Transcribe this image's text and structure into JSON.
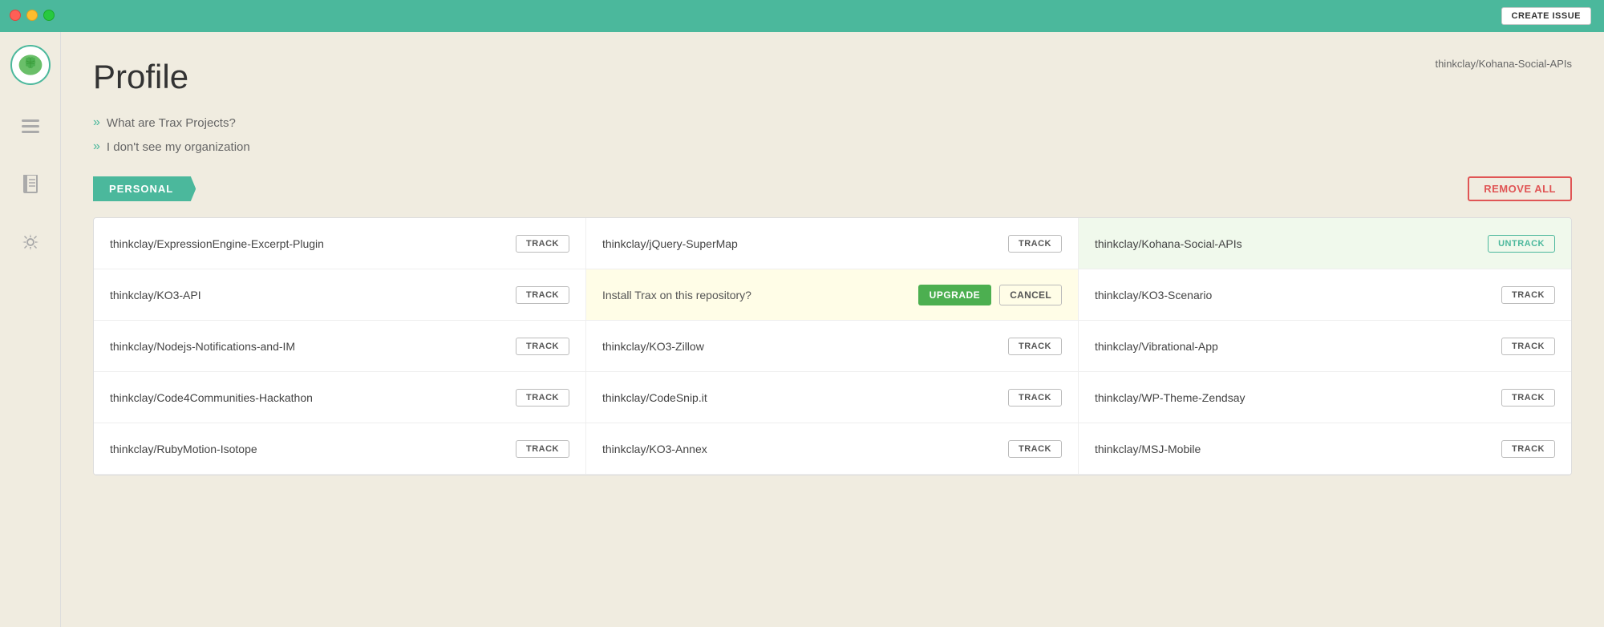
{
  "titlebar": {
    "create_issue_label": "CREATE ISSUE"
  },
  "sidebar": {
    "avatar_alt": "brain avatar",
    "icons": [
      {
        "name": "list-icon",
        "symbol": "☰"
      },
      {
        "name": "book-icon",
        "symbol": "📖"
      },
      {
        "name": "gear-icon",
        "symbol": "⚙"
      }
    ]
  },
  "page": {
    "title": "Profile",
    "top_right_repo": "thinkclay/Kohana-Social-APIs",
    "faq": [
      {
        "text": "What are Trax Projects?"
      },
      {
        "text": "I don't see my organization"
      }
    ]
  },
  "personal_section": {
    "label": "PERSONAL",
    "remove_all_label": "REMOVE ALL"
  },
  "repos": [
    {
      "col": 0,
      "name": "thinkclay/ExpressionEngine-Excerpt-Plugin",
      "action": "track",
      "highlighted": false,
      "yellow": false
    },
    {
      "col": 1,
      "name": "thinkclay/jQuery-SuperMap",
      "action": "track",
      "highlighted": false,
      "yellow": false
    },
    {
      "col": 2,
      "name": "thinkclay/Kohana-Social-APIs",
      "action": "untrack",
      "highlighted": true,
      "yellow": false
    },
    {
      "col": 0,
      "name": "thinkclay/KO3-API",
      "action": "track",
      "highlighted": false,
      "yellow": false
    },
    {
      "col": 1,
      "name": "Install Trax on this repository?",
      "action": "upgrade_cancel",
      "highlighted": false,
      "yellow": true,
      "upgrade_label": "UPGRADE",
      "cancel_label": "CANCEL"
    },
    {
      "col": 2,
      "name": "thinkclay/KO3-Scenario",
      "action": "track",
      "highlighted": false,
      "yellow": false
    },
    {
      "col": 0,
      "name": "thinkclay/Nodejs-Notifications-and-IM",
      "action": "track",
      "highlighted": false,
      "yellow": false
    },
    {
      "col": 1,
      "name": "thinkclay/KO3-Zillow",
      "action": "track",
      "highlighted": false,
      "yellow": false
    },
    {
      "col": 2,
      "name": "thinkclay/Vibrational-App",
      "action": "track",
      "highlighted": false,
      "yellow": false
    },
    {
      "col": 0,
      "name": "thinkclay/Code4Communities-Hackathon",
      "action": "track",
      "highlighted": false,
      "yellow": false
    },
    {
      "col": 1,
      "name": "thinkclay/CodeSnip.it",
      "action": "track",
      "highlighted": false,
      "yellow": false
    },
    {
      "col": 2,
      "name": "thinkclay/WP-Theme-Zendsay",
      "action": "track",
      "highlighted": false,
      "yellow": false
    },
    {
      "col": 0,
      "name": "thinkclay/RubyMotion-Isotope",
      "action": "track",
      "highlighted": false,
      "yellow": false
    },
    {
      "col": 1,
      "name": "thinkclay/KO3-Annex",
      "action": "track",
      "highlighted": false,
      "yellow": false
    },
    {
      "col": 2,
      "name": "thinkclay/MSJ-Mobile",
      "action": "track",
      "highlighted": false,
      "yellow": false
    }
  ]
}
